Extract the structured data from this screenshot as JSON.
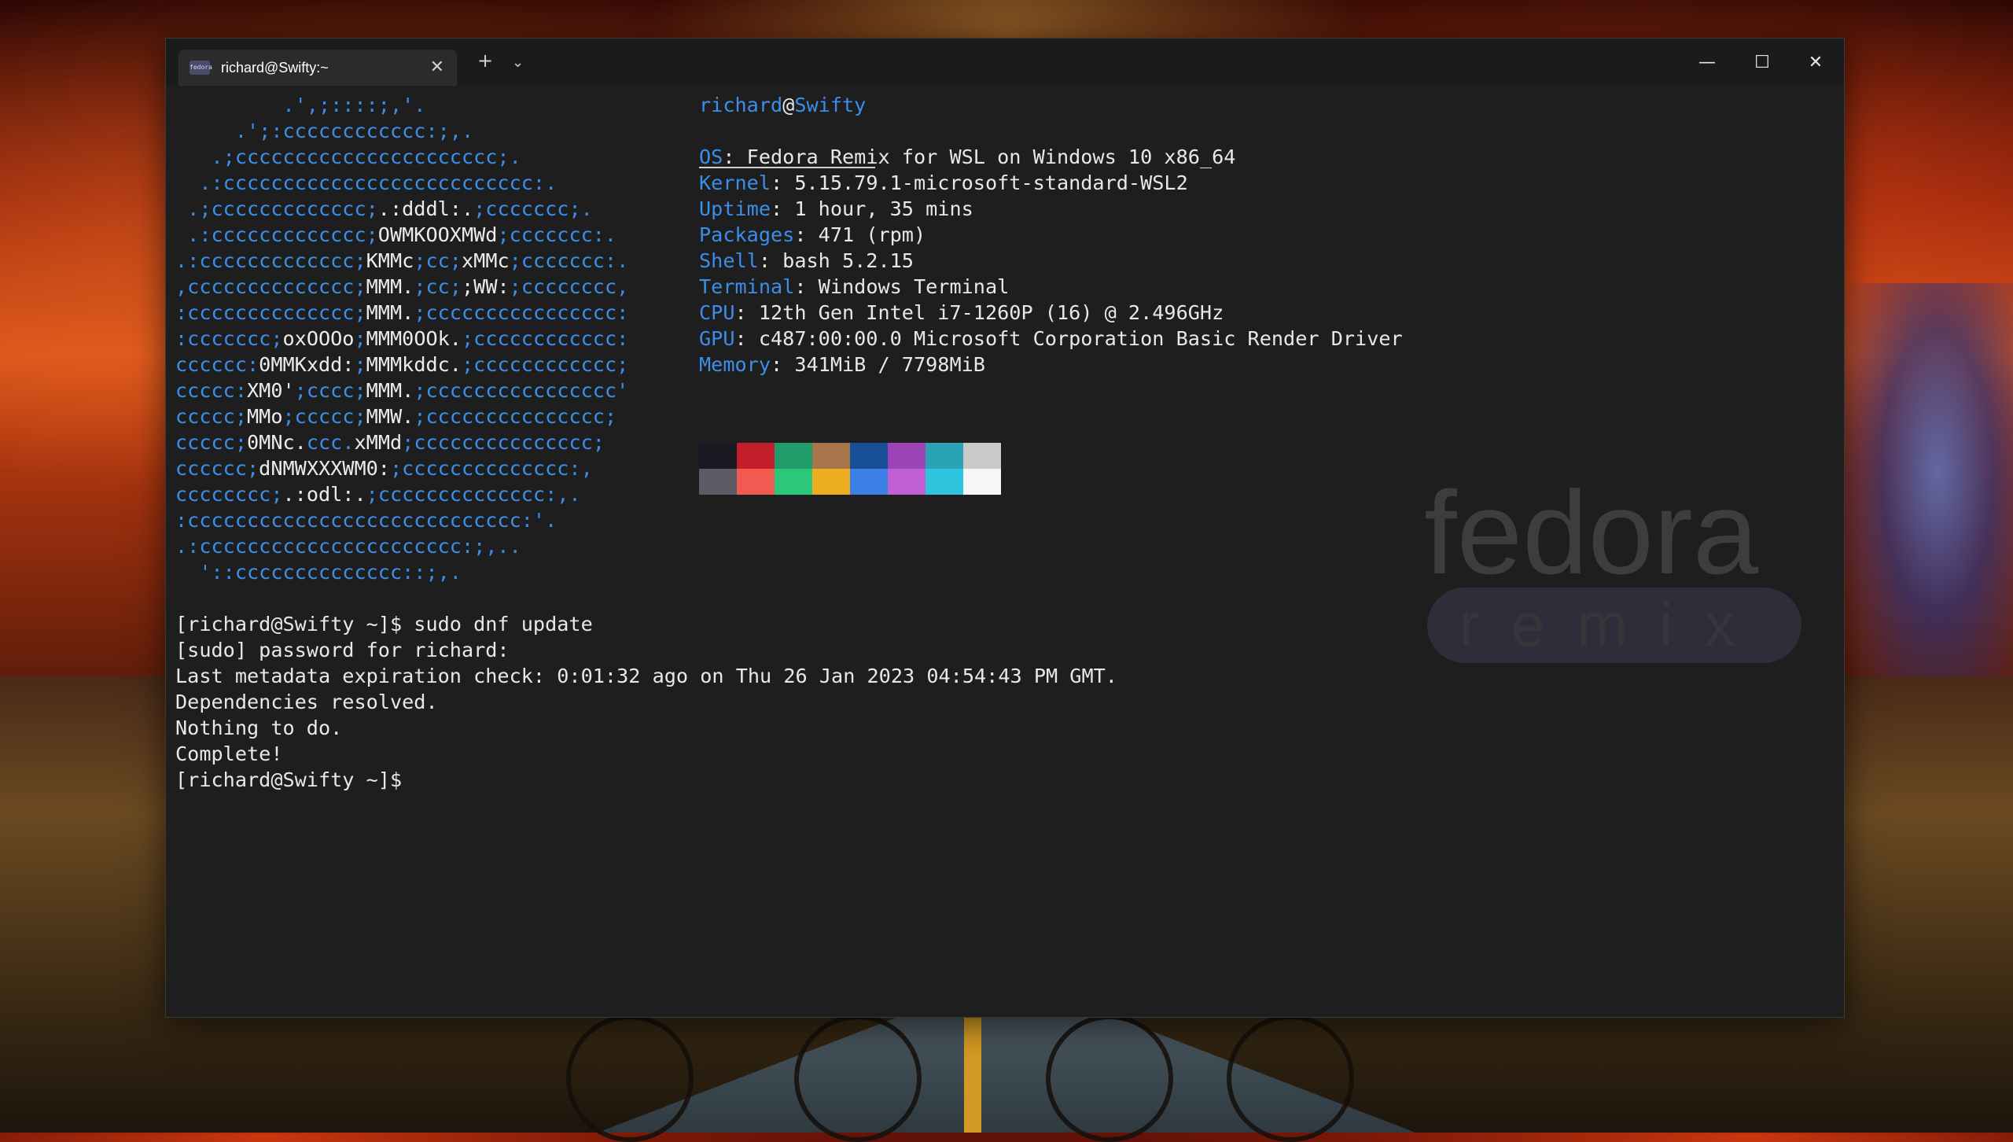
{
  "window": {
    "tab_title": "richard@Swifty:~",
    "tab_icon_label": "fedora",
    "new_tab_icon": "plus-icon",
    "dropdown_icon": "chevron-down-icon",
    "controls": [
      "minimize-icon",
      "maximize-icon",
      "close-icon"
    ]
  },
  "logo": [
    [
      [
        "blue",
        "         .',;::::;,'.         "
      ]
    ],
    [
      [
        "blue",
        "     .';:cccccccccccc:;,.     "
      ]
    ],
    [
      [
        "blue",
        "   .;cccccccccccccccccccccc;.   "
      ]
    ],
    [
      [
        "blue",
        "  .:cccccccccccccccccccccccccc:.  "
      ]
    ],
    [
      [
        "blue",
        " .;ccccccccccccc;"
      ],
      [
        "white",
        ".:dddl:."
      ],
      [
        "blue",
        ";ccccccc;. "
      ]
    ],
    [
      [
        "blue",
        " .:ccccccccccccc;"
      ],
      [
        "white",
        "OWMKOOXMWd"
      ],
      [
        "blue",
        ";ccccccc:. "
      ]
    ],
    [
      [
        "blue",
        ".:ccccccccccccc;"
      ],
      [
        "white",
        "KMMc"
      ],
      [
        "blue",
        ";cc;"
      ],
      [
        "white",
        "xMMc"
      ],
      [
        "blue",
        ";ccccccc:."
      ]
    ],
    [
      [
        "blue",
        ",cccccccccccccc;"
      ],
      [
        "white",
        "MMM."
      ],
      [
        "blue",
        ";cc;"
      ],
      [
        "white",
        ";WW:"
      ],
      [
        "blue",
        ";cccccccc,"
      ]
    ],
    [
      [
        "blue",
        ":cccccccccccccc;"
      ],
      [
        "white",
        "MMM."
      ],
      [
        "blue",
        ";cccccccccccccccc:"
      ]
    ],
    [
      [
        "blue",
        ":ccccccc;"
      ],
      [
        "white",
        "oxOOOo"
      ],
      [
        "blue",
        ";"
      ],
      [
        "white",
        "MMM0OOk."
      ],
      [
        "blue",
        ";cccccccccccc:"
      ]
    ],
    [
      [
        "blue",
        "cccccc:"
      ],
      [
        "white",
        "0MMKxdd:"
      ],
      [
        "blue",
        ";"
      ],
      [
        "white",
        "MMMkddc."
      ],
      [
        "blue",
        ";cccccccccccc;"
      ]
    ],
    [
      [
        "blue",
        "ccccc:"
      ],
      [
        "white",
        "XM0'"
      ],
      [
        "blue",
        ";cccc;"
      ],
      [
        "white",
        "MMM."
      ],
      [
        "blue",
        ";cccccccccccccccc'"
      ]
    ],
    [
      [
        "blue",
        "ccccc;"
      ],
      [
        "white",
        "MMo"
      ],
      [
        "blue",
        ";ccccc;"
      ],
      [
        "white",
        "MMW."
      ],
      [
        "blue",
        ";ccccccccccccccc;"
      ]
    ],
    [
      [
        "blue",
        "ccccc;"
      ],
      [
        "white",
        "0MNc."
      ],
      [
        "blue",
        "ccc."
      ],
      [
        "white",
        "xMMd"
      ],
      [
        "blue",
        ";ccccccccccccccc;"
      ]
    ],
    [
      [
        "blue",
        "cccccc;"
      ],
      [
        "white",
        "dNMWXXXWM0:"
      ],
      [
        "blue",
        ";cccccccccccccc:,"
      ]
    ],
    [
      [
        "blue",
        "cccccccc;"
      ],
      [
        "white",
        ".:odl:."
      ],
      [
        "blue",
        ";cccccccccccccc:,."
      ]
    ],
    [
      [
        "blue",
        ":cccccccccccccccccccccccccccc:'."
      ]
    ],
    [
      [
        "blue",
        ".:cccccccccccccccccccccc:;,.."
      ]
    ],
    [
      [
        "blue",
        "  '::cccccccccccccc::;,."
      ]
    ]
  ],
  "info": {
    "user": "richard",
    "at": "@",
    "host": "Swifty",
    "rows": [
      {
        "key": "OS",
        "value": ": Fedora Remix for WSL on Windows 10 x86_64"
      },
      {
        "key": "Kernel",
        "value": ": 5.15.79.1-microsoft-standard-WSL2"
      },
      {
        "key": "Uptime",
        "value": ": 1 hour, 35 mins"
      },
      {
        "key": "Packages",
        "value": ": 471 (rpm)"
      },
      {
        "key": "Shell",
        "value": ": bash 5.2.15"
      },
      {
        "key": "Terminal",
        "value": ": Windows Terminal"
      },
      {
        "key": "CPU",
        "value": ": 12th Gen Intel i7-1260P (16) @ 2.496GHz"
      },
      {
        "key": "GPU",
        "value": ": c487:00:00.0 Microsoft Corporation Basic Render Driver"
      },
      {
        "key": "Memory",
        "value": ": 341MiB / 7798MiB"
      }
    ],
    "palette_top": [
      "#1a1820",
      "#c51e2b",
      "#1f9c6a",
      "#a6754a",
      "#184f97",
      "#9a44b6",
      "#2aa3b6",
      "#c9c9c9"
    ],
    "palette_bottom": [
      "#5c5b63",
      "#f05a50",
      "#2bc77a",
      "#ecae1e",
      "#3b80e6",
      "#c160d4",
      "#2fc4dd",
      "#f6f6f6"
    ]
  },
  "output": [
    "[richard@Swifty ~]$ sudo dnf update",
    "[sudo] password for richard:",
    "Last metadata expiration check: 0:01:32 ago on Thu 26 Jan 2023 04:54:43 PM GMT.",
    "Dependencies resolved.",
    "Nothing to do.",
    "Complete!",
    "[richard@Swifty ~]$ "
  ],
  "watermark": {
    "word": "fedora",
    "sub": "remix"
  }
}
